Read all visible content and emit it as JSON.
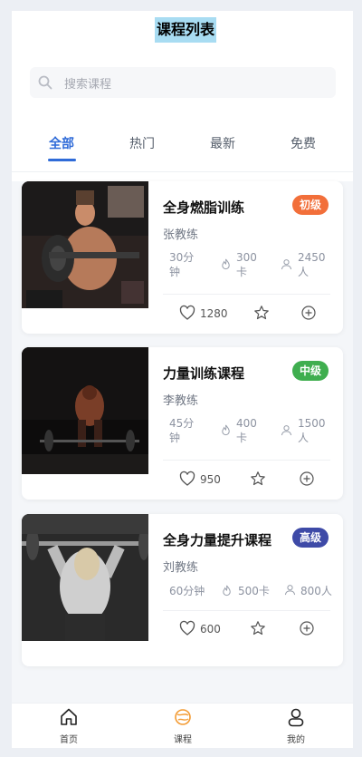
{
  "header": {
    "title": "课程列表"
  },
  "search": {
    "placeholder": "搜索课程"
  },
  "tabs": [
    {
      "label": "全部",
      "active": true
    },
    {
      "label": "热门"
    },
    {
      "label": "最新"
    },
    {
      "label": "免费"
    }
  ],
  "courses": [
    {
      "title": "全身燃脂训练",
      "coach": "张教练",
      "level": "初级",
      "level_color": "#f26f3a",
      "duration_a": "30分",
      "duration_b": "钟",
      "calories_a": "300",
      "calories_b": "卡",
      "people_a": "2450",
      "people_b": "人",
      "likes": "1280",
      "image": "man-barbell-curl-photo"
    },
    {
      "title": "力量训练课程",
      "coach": "李教练",
      "level": "中级",
      "level_color": "#3fae4f",
      "duration_a": "45分",
      "duration_b": "钟",
      "calories_a": "400",
      "calories_b": "卡",
      "people_a": "1500",
      "people_b": "人",
      "likes": "950",
      "image": "deadlift-dark-photo"
    },
    {
      "title": "全身力量提升课程",
      "coach": "刘教练",
      "level": "高级",
      "level_color": "#3e4aa7",
      "duration": "60分钟",
      "calories": "500卡",
      "people": "800人",
      "likes": "600",
      "image": "woman-overhead-barbell-photo"
    }
  ],
  "bottom_nav": [
    {
      "label": "首页",
      "icon": "home-icon"
    },
    {
      "label": "课程",
      "icon": "course-icon",
      "active": true
    },
    {
      "label": "我的",
      "icon": "profile-icon"
    }
  ],
  "colors": {
    "accent": "#2f6bd8",
    "nav_active": "#f39a31"
  }
}
